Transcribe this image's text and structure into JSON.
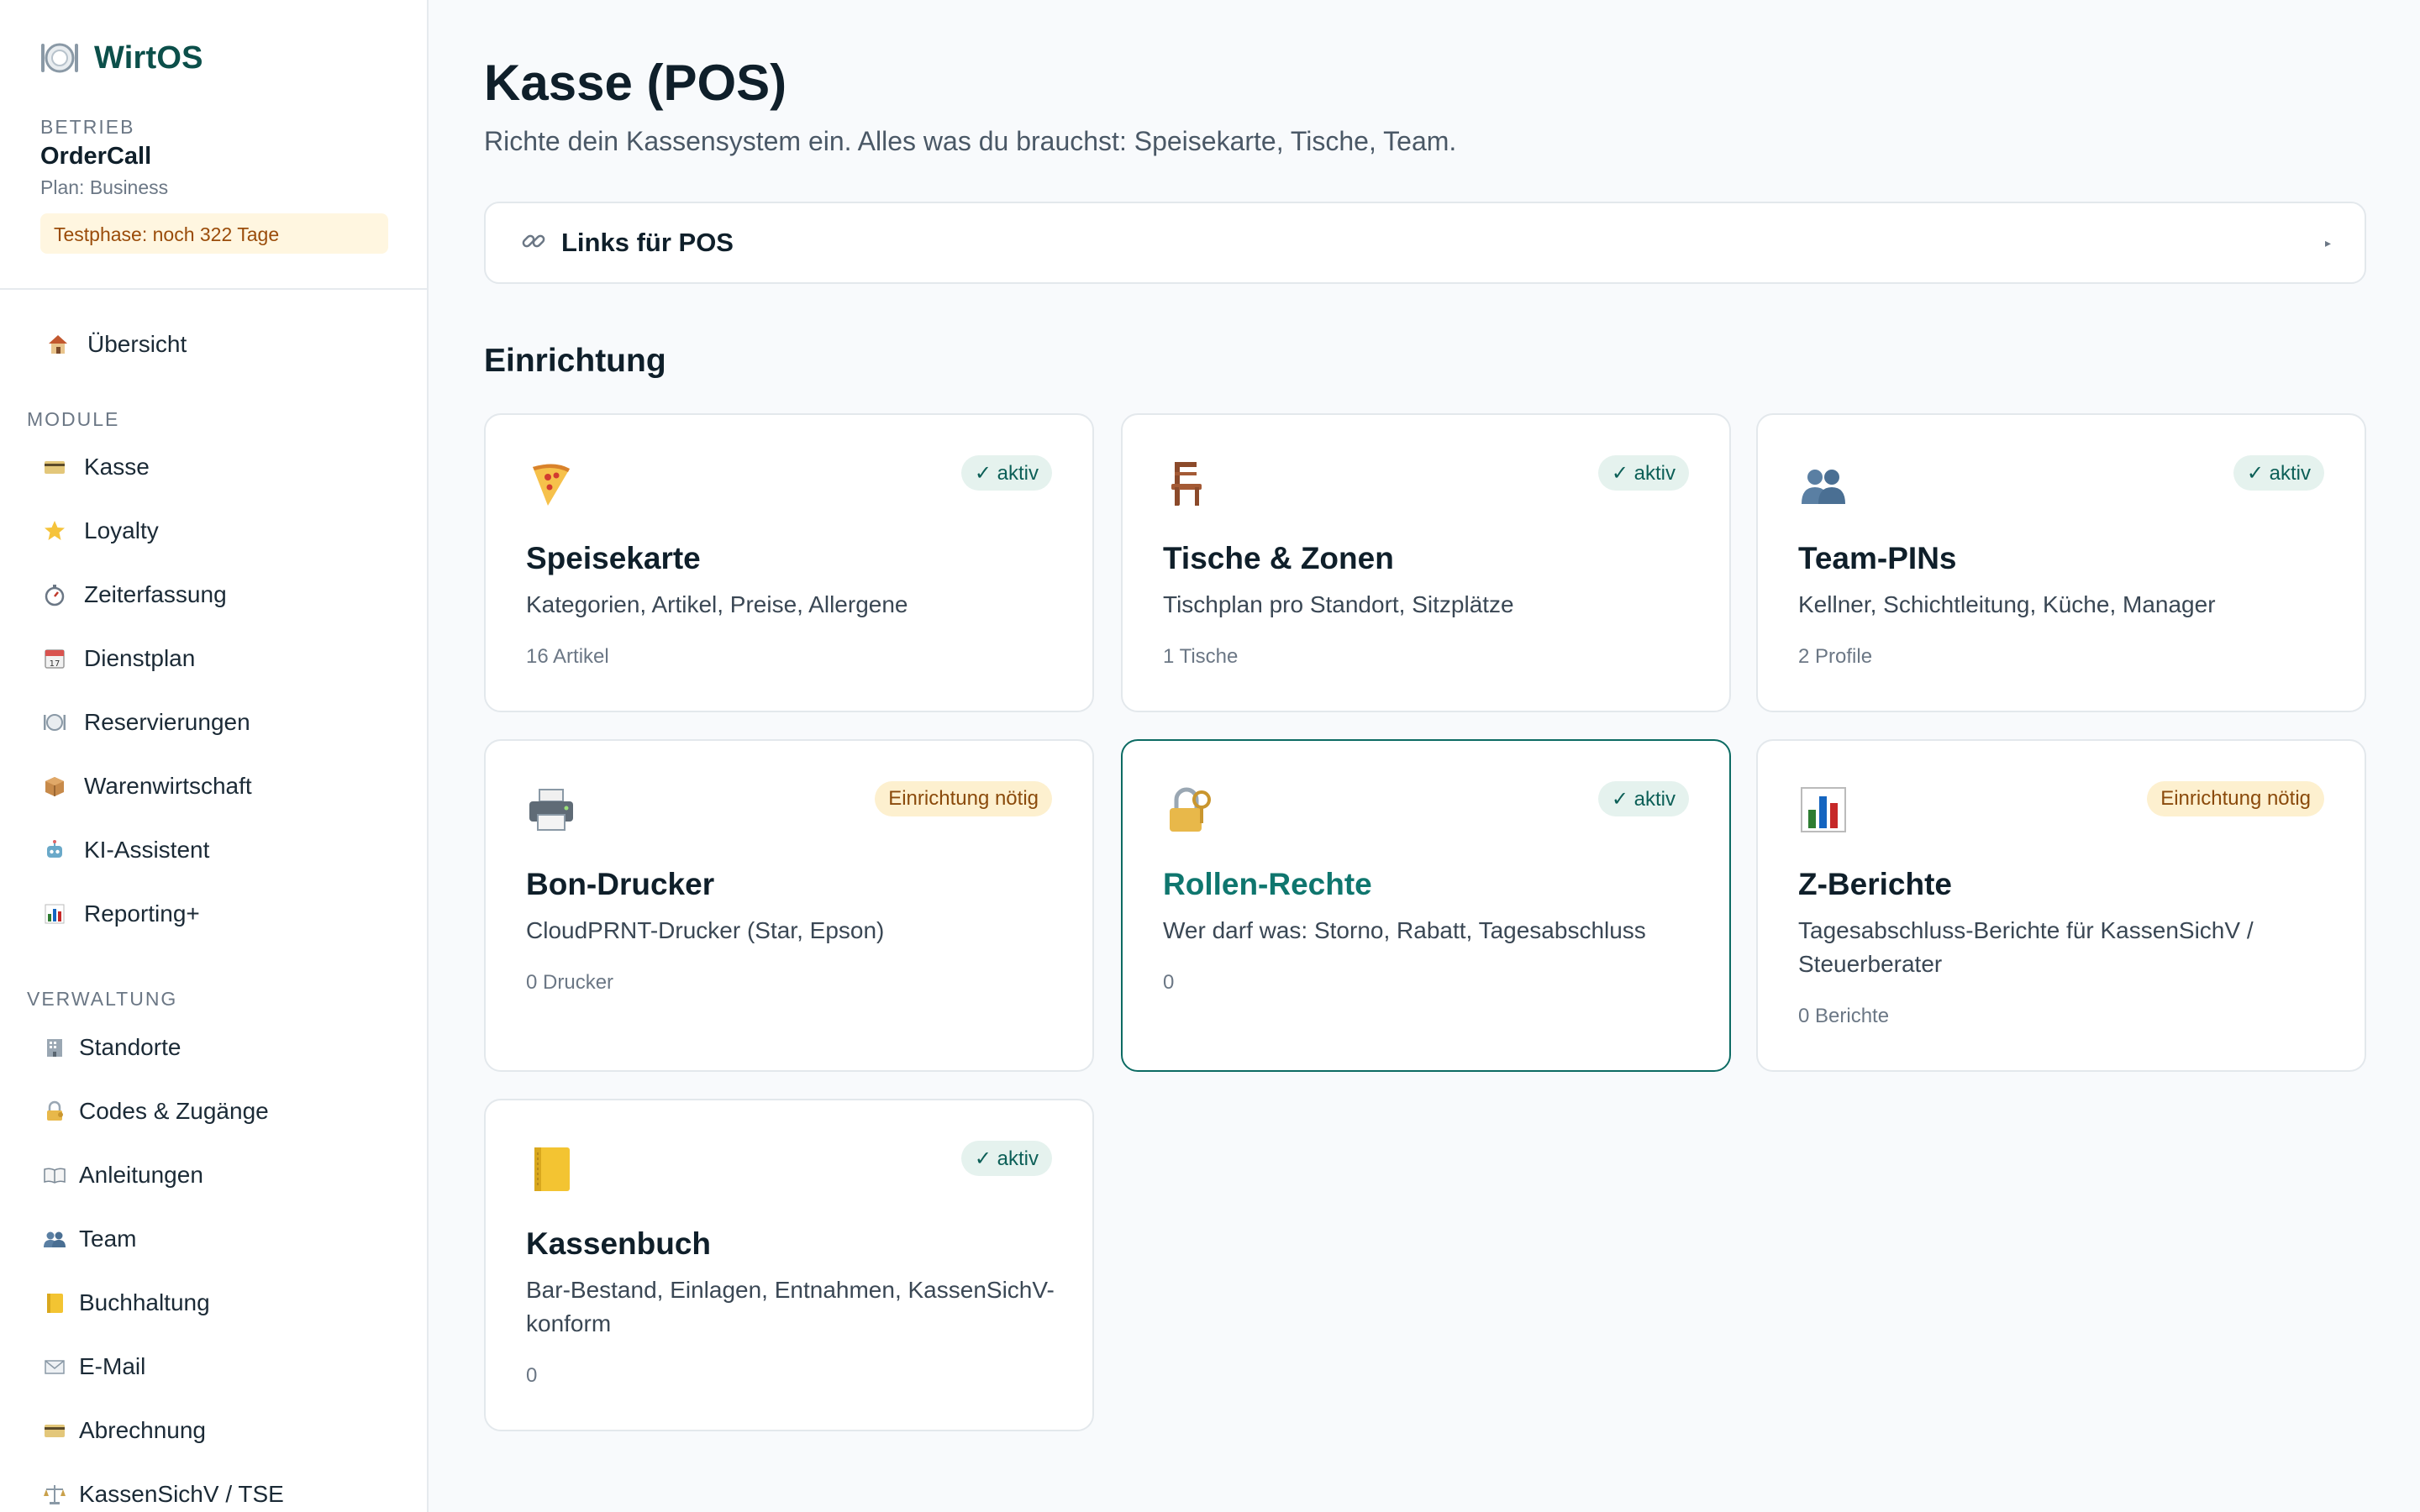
{
  "brand": {
    "name": "WirtOS"
  },
  "business": {
    "label": "BETRIEB",
    "name": "OrderCall",
    "plan": "Plan: Business",
    "trial": "Testphase: noch 322 Tage"
  },
  "nav": {
    "overview": "Übersicht",
    "modules_label": "MODULE",
    "modules": [
      {
        "label": "Kasse",
        "icon": "credit-card-icon"
      },
      {
        "label": "Loyalty",
        "icon": "star-icon"
      },
      {
        "label": "Zeiterfassung",
        "icon": "stopwatch-icon"
      },
      {
        "label": "Dienstplan",
        "icon": "calendar-icon"
      },
      {
        "label": "Reservierungen",
        "icon": "plate-icon"
      },
      {
        "label": "Warenwirtschaft",
        "icon": "package-icon"
      },
      {
        "label": "KI-Assistent",
        "icon": "robot-icon"
      },
      {
        "label": "Reporting+",
        "icon": "bar-chart-icon"
      }
    ],
    "admin_label": "VERWALTUNG",
    "admin": [
      {
        "label": "Standorte",
        "icon": "office-icon"
      },
      {
        "label": "Codes & Zugänge",
        "icon": "lock-key-icon"
      },
      {
        "label": "Anleitungen",
        "icon": "book-icon"
      },
      {
        "label": "Team",
        "icon": "people-icon"
      },
      {
        "label": "Buchhaltung",
        "icon": "ledger-icon"
      },
      {
        "label": "E-Mail",
        "icon": "envelope-icon"
      },
      {
        "label": "Abrechnung",
        "icon": "credit-card-icon"
      },
      {
        "label": "KassenSichV / TSE",
        "icon": "scales-icon"
      }
    ]
  },
  "main": {
    "title": "Kasse (POS)",
    "subtitle": "Richte dein Kassensystem ein. Alles was du brauchst: Speisekarte, Tische, Team.",
    "links_panel": "Links für POS",
    "section_title": "Einrichtung",
    "cards": [
      {
        "title": "Speisekarte",
        "desc": "Kategorien, Artikel, Preise, Allergene",
        "meta": "16 Artikel",
        "badge": "✓ aktiv",
        "status": "ok",
        "icon": "pizza-icon"
      },
      {
        "title": "Tische & Zonen",
        "desc": "Tischplan pro Standort, Sitzplätze",
        "meta": "1 Tische",
        "badge": "✓ aktiv",
        "status": "ok",
        "icon": "chair-icon"
      },
      {
        "title": "Team-PINs",
        "desc": "Kellner, Schichtleitung, Küche, Manager",
        "meta": "2 Profile",
        "badge": "✓ aktiv",
        "status": "ok",
        "icon": "people-icon"
      },
      {
        "title": "Bon-Drucker",
        "desc": "CloudPRNT-Drucker (Star, Epson)",
        "meta": "0 Drucker",
        "badge": "Einrichtung nötig",
        "status": "warn",
        "icon": "printer-icon"
      },
      {
        "title": "Rollen-Rechte",
        "desc": "Wer darf was: Storno, Rabatt, Tagesabschluss",
        "meta": "0",
        "badge": "✓ aktiv",
        "status": "ok",
        "icon": "lock-key-icon"
      },
      {
        "title": "Z-Berichte",
        "desc": "Tagesabschluss-Berichte für KassenSichV / Steuerberater",
        "meta": "0 Berichte",
        "badge": "Einrichtung nötig",
        "status": "warn",
        "icon": "bar-chart-icon"
      },
      {
        "title": "Kassenbuch",
        "desc": "Bar-Bestand, Einlagen, Entnahmen, KassenSichV-konform",
        "meta": "0",
        "badge": "✓ aktiv",
        "status": "ok",
        "icon": "ledger-icon"
      }
    ]
  }
}
